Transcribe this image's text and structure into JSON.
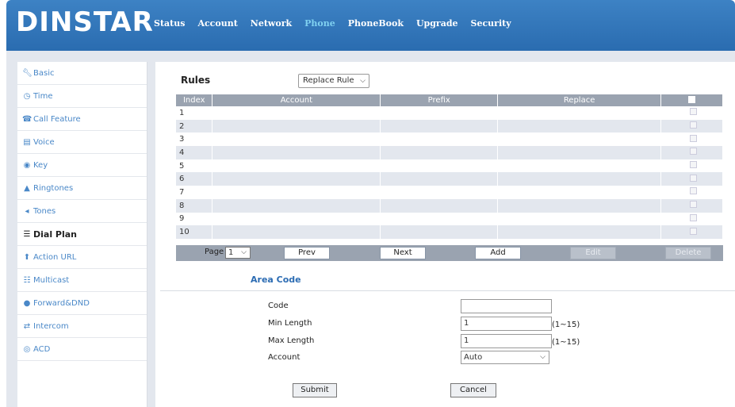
{
  "brand": {
    "logo": "DINSTAR"
  },
  "nav": {
    "items": [
      "Status",
      "Account",
      "Network",
      "Phone",
      "PhoneBook",
      "Upgrade",
      "Security"
    ],
    "active": "Phone"
  },
  "sidebar": {
    "items": [
      {
        "label": "Basic",
        "icon": "wrench-icon"
      },
      {
        "label": "Time",
        "icon": "clock-icon"
      },
      {
        "label": "Call Feature",
        "icon": "phone-icon"
      },
      {
        "label": "Voice",
        "icon": "voice-icon"
      },
      {
        "label": "Key",
        "icon": "key-icon"
      },
      {
        "label": "Ringtones",
        "icon": "bell-icon"
      },
      {
        "label": "Tones",
        "icon": "speaker-icon"
      },
      {
        "label": "Dial Plan",
        "icon": "dialplan-icon"
      },
      {
        "label": "Action URL",
        "icon": "upload-icon"
      },
      {
        "label": "Multicast",
        "icon": "multicast-icon"
      },
      {
        "label": "Forward&DND",
        "icon": "forward-icon"
      },
      {
        "label": "Intercom",
        "icon": "intercom-icon"
      },
      {
        "label": "ACD",
        "icon": "acd-icon"
      }
    ],
    "active": "Dial Plan"
  },
  "rules": {
    "title": "Rules",
    "rule_type": "Replace Rule",
    "columns": [
      "Index",
      "Account",
      "Prefix",
      "Replace"
    ],
    "rows": [
      "1",
      "2",
      "3",
      "4",
      "5",
      "6",
      "7",
      "8",
      "9",
      "10"
    ]
  },
  "pager": {
    "page_label": "Page",
    "page_value": "1",
    "prev": "Prev",
    "next": "Next",
    "add": "Add",
    "edit": "Edit",
    "delete": "Delete"
  },
  "area_code": {
    "title": "Area Code",
    "code_label": "Code",
    "code_value": "",
    "min_label": "Min Length",
    "min_value": "1",
    "min_range": "(1~15)",
    "max_label": "Max Length",
    "max_value": "1",
    "max_range": "(1~15)",
    "account_label": "Account",
    "account_value": "Auto",
    "submit": "Submit",
    "cancel": "Cancel"
  },
  "colors": {
    "header": "#3d82c4",
    "active_nav": "#7fd0f0",
    "table_header": "#9aa3b0",
    "link": "#4a88c8"
  }
}
